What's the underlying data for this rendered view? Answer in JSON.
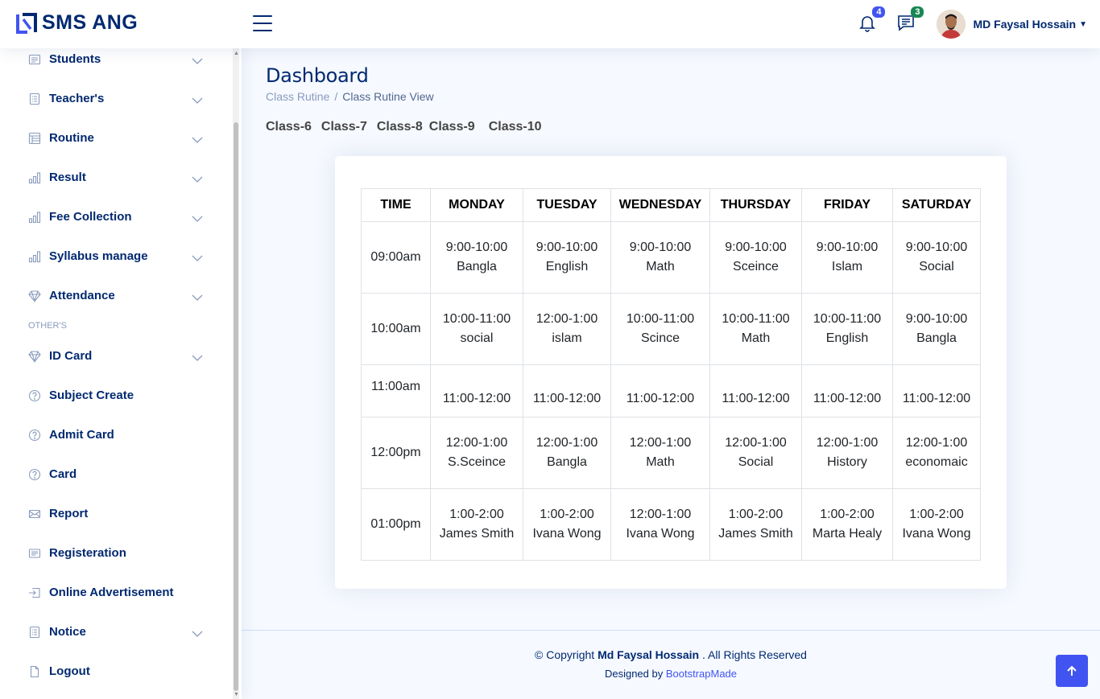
{
  "header": {
    "logo_text": "SMS ANG",
    "notifications_count": "4",
    "messages_count": "3",
    "user_name": "MD Faysal Hossain"
  },
  "sidebar": {
    "items": [
      {
        "label": "Students",
        "icon": "list-icon",
        "has_chevron": true
      },
      {
        "label": "Teacher's",
        "icon": "document-icon",
        "has_chevron": true
      },
      {
        "label": "Routine",
        "icon": "table-icon",
        "has_chevron": true
      },
      {
        "label": "Result",
        "icon": "bar-chart-icon",
        "has_chevron": true
      },
      {
        "label": "Fee Collection",
        "icon": "bar-chart-icon",
        "has_chevron": true
      },
      {
        "label": "Syllabus manage",
        "icon": "bar-chart-icon",
        "has_chevron": true
      },
      {
        "label": "Attendance",
        "icon": "gem-icon",
        "has_chevron": true
      }
    ],
    "section_heading": "OTHER'S",
    "other_items": [
      {
        "label": "ID Card",
        "icon": "gem-icon",
        "has_chevron": true
      },
      {
        "label": "Subject Create",
        "icon": "question-circle-icon",
        "has_chevron": false
      },
      {
        "label": "Admit Card",
        "icon": "question-circle-icon",
        "has_chevron": false
      },
      {
        "label": "Card",
        "icon": "question-circle-icon",
        "has_chevron": false
      },
      {
        "label": "Report",
        "icon": "envelope-icon",
        "has_chevron": false
      },
      {
        "label": "Registeration",
        "icon": "card-list-icon",
        "has_chevron": false
      },
      {
        "label": "Online Advertisement",
        "icon": "box-arrow-in-icon",
        "has_chevron": false
      },
      {
        "label": "Notice",
        "icon": "document-icon",
        "has_chevron": true
      },
      {
        "label": "Logout",
        "icon": "file-icon",
        "has_chevron": false
      }
    ]
  },
  "page": {
    "title": "Dashboard",
    "breadcrumb": [
      "Class Rutine",
      "Class Rutine View"
    ],
    "class_tabs": [
      "Class-6",
      "Class-7",
      "Class-8",
      "Class-9",
      "Class-10"
    ]
  },
  "routine": {
    "headers": [
      "TIME",
      "MONDAY",
      "TUESDAY",
      "WEDNESDAY",
      "THURSDAY",
      "FRIDAY",
      "SATURDAY"
    ],
    "rows": [
      {
        "time": "09:00am",
        "cells": [
          [
            "9:00-10:00",
            "Bangla"
          ],
          [
            "9:00-10:00",
            "English"
          ],
          [
            "9:00-10:00",
            "Math"
          ],
          [
            "9:00-10:00",
            "Sceince"
          ],
          [
            "9:00-10:00",
            "Islam"
          ],
          [
            "9:00-10:00",
            "Social"
          ]
        ]
      },
      {
        "time": "10:00am",
        "cells": [
          [
            "10:00-11:00",
            "social"
          ],
          [
            "12:00-1:00",
            "islam"
          ],
          [
            "10:00-11:00",
            "Scince"
          ],
          [
            "10:00-11:00",
            "Math"
          ],
          [
            "10:00-11:00",
            "English"
          ],
          [
            "9:00-10:00",
            "Bangla"
          ]
        ]
      },
      {
        "time": "11:00am",
        "cells": [
          [
            "11:00-12:00"
          ],
          [
            "11:00-12:00"
          ],
          [
            "11:00-12:00"
          ],
          [
            "11:00-12:00"
          ],
          [
            "11:00-12:00"
          ],
          [
            "11:00-12:00"
          ]
        ]
      },
      {
        "time": "12:00pm",
        "cells": [
          [
            "12:00-1:00",
            "S.Sceince"
          ],
          [
            "12:00-1:00",
            "Bangla"
          ],
          [
            "12:00-1:00",
            "Math"
          ],
          [
            "12:00-1:00",
            "Social"
          ],
          [
            "12:00-1:00",
            "History"
          ],
          [
            "12:00-1:00",
            "economaic"
          ]
        ]
      },
      {
        "time": "01:00pm",
        "cells": [
          [
            "1:00-2:00",
            "James Smith"
          ],
          [
            "1:00-2:00",
            "Ivana Wong"
          ],
          [
            "12:00-1:00",
            "Ivana Wong"
          ],
          [
            "1:00-2:00",
            "James Smith"
          ],
          [
            "1:00-2:00",
            "Marta Healy"
          ],
          [
            "1:00-2:00",
            "Ivana Wong"
          ]
        ]
      }
    ]
  },
  "footer": {
    "copyright_prefix": "© Copyright",
    "copyright_name": "Md Faysal Hossain",
    "copyright_suffix": ". All Rights Reserved",
    "designed_by": "Designed by",
    "designer_link": "BootstrapMade"
  },
  "colors": {
    "primary": "#4154f1",
    "navy": "#012970",
    "muted": "#899bbd",
    "background": "#f6f9ff"
  }
}
